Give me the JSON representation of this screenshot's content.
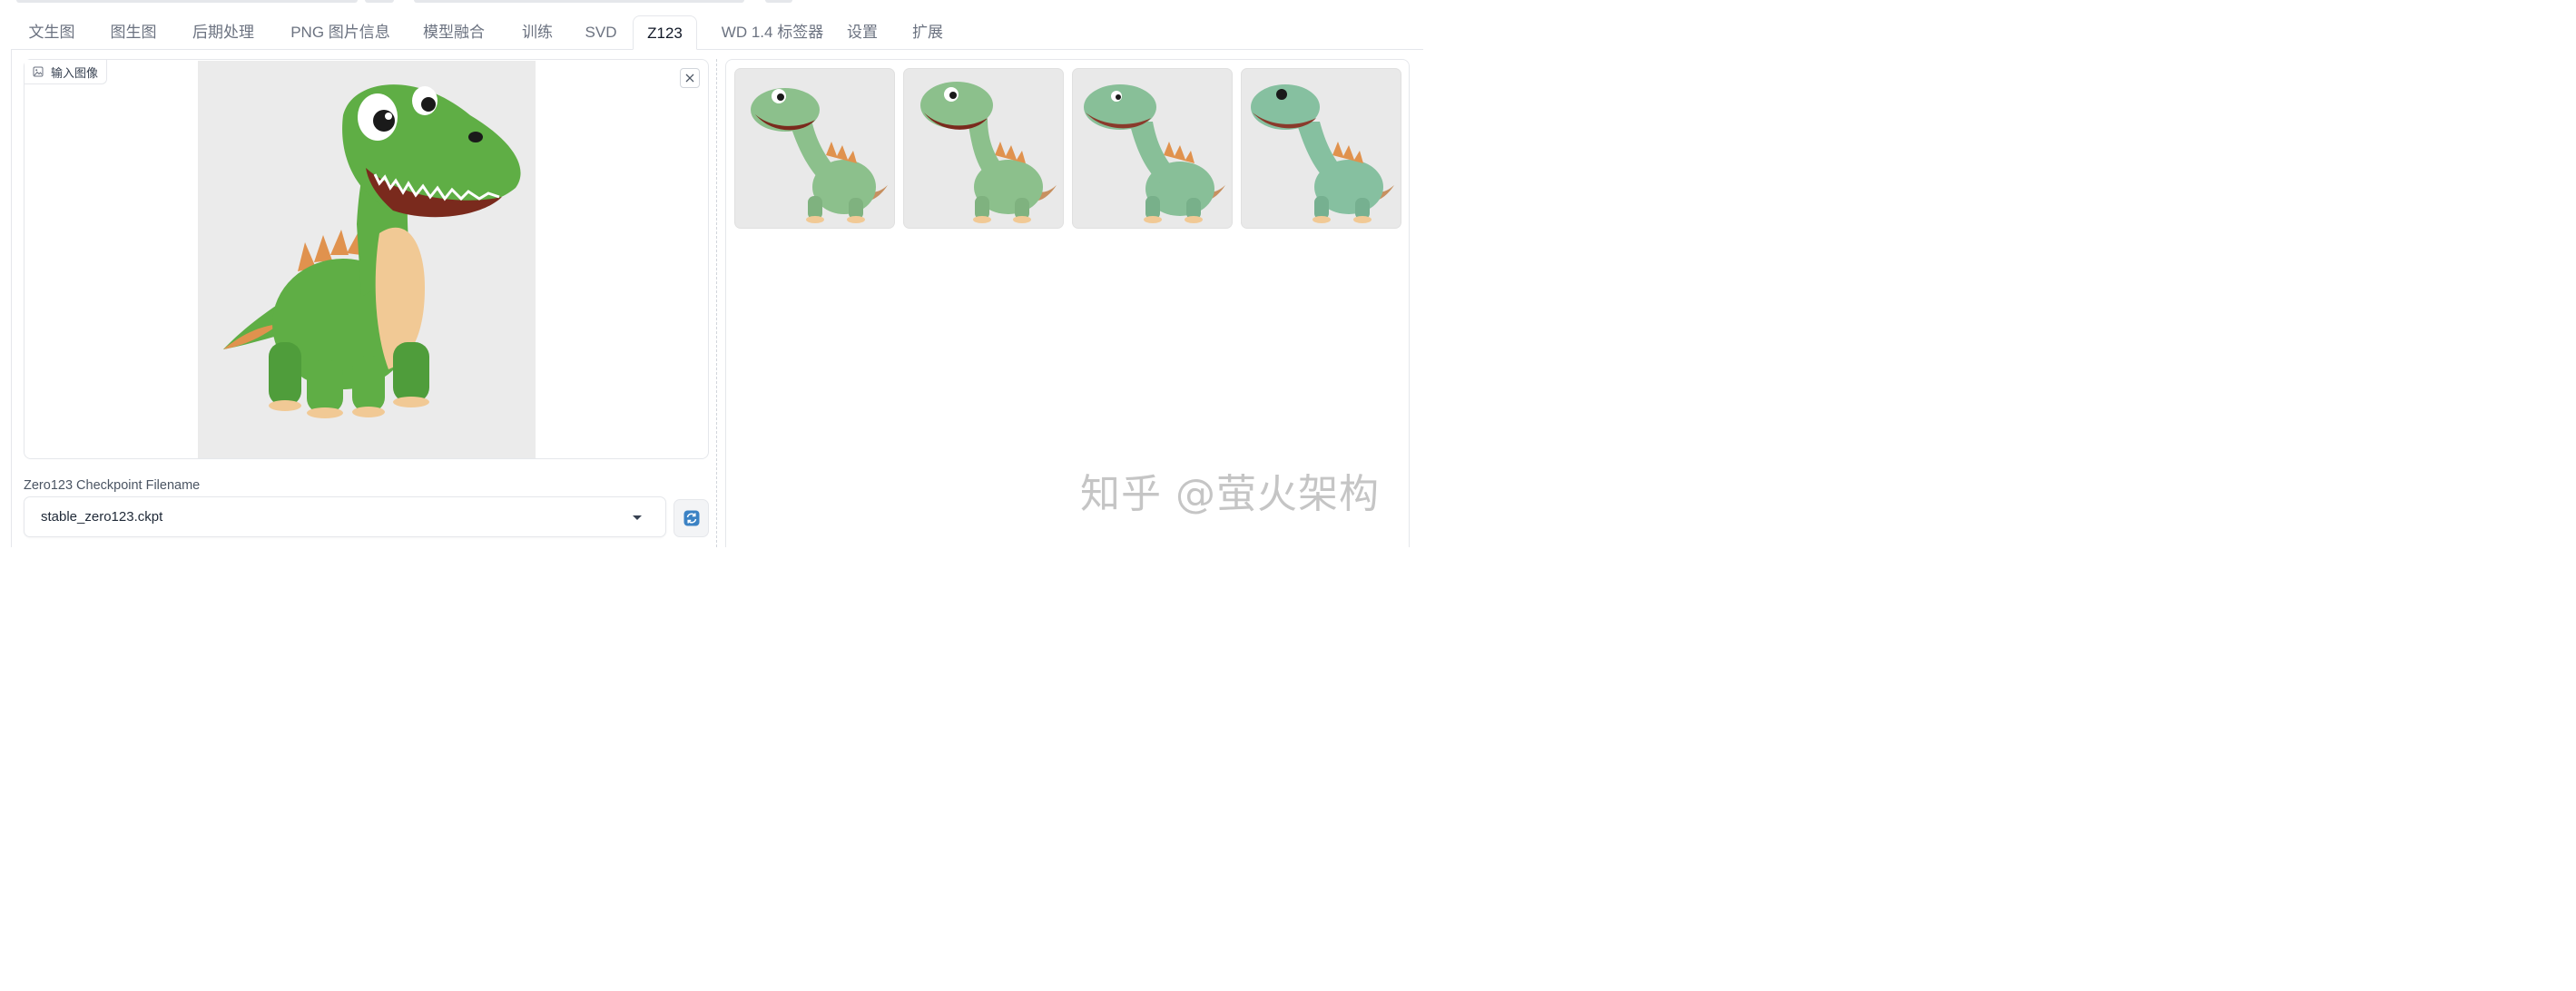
{
  "tabs": [
    {
      "label": "文生图"
    },
    {
      "label": "图生图"
    },
    {
      "label": "后期处理"
    },
    {
      "label": "PNG 图片信息"
    },
    {
      "label": "模型融合"
    },
    {
      "label": "训练"
    },
    {
      "label": "SVD"
    },
    {
      "label": "Z123",
      "active": true
    },
    {
      "label": "WD 1.4 标签器"
    },
    {
      "label": "设置"
    },
    {
      "label": "扩展"
    }
  ],
  "input_image": {
    "label": "输入图像",
    "icon": "image-icon",
    "close_icon": "close-icon"
  },
  "checkpoint": {
    "label": "Zero123 Checkpoint Filename",
    "value": "stable_zero123.ckpt",
    "refresh_icon": "refresh-icon"
  },
  "gallery": {
    "count": 4
  },
  "watermark": "知乎 @萤火架构",
  "colors": {
    "dino_green": "#5fae45",
    "dino_belly": "#f1c995",
    "spikes": "#e0924e",
    "refresh_blue": "#3b82c4",
    "thumb_green": "#8cc08c"
  }
}
